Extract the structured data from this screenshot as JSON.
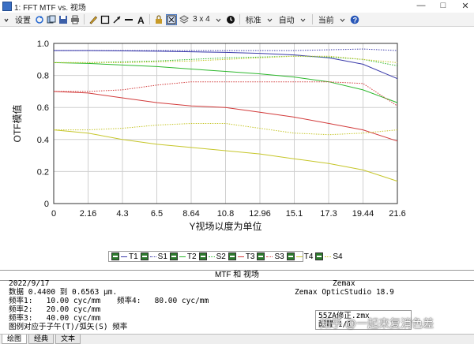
{
  "window": {
    "title": "1: FFT MTF vs. 视场",
    "minimize": "—",
    "maximize": "□",
    "close": "✕"
  },
  "toolbar": {
    "settings_label": "设置",
    "layout_label": "3 x 4",
    "standard_label": "标准",
    "auto_label": "自动",
    "current_label": "当前"
  },
  "chart_data": {
    "type": "line",
    "xlabel": "Y视场以度为单位",
    "ylabel": "OTF模值",
    "xlim": [
      0,
      21.6
    ],
    "ylim": [
      0,
      1.0
    ],
    "xticks": [
      "0",
      "2.16",
      "4.3",
      "6.5",
      "8.64",
      "10.8",
      "12.96",
      "15.1",
      "17.3",
      "19.44",
      "21.6"
    ],
    "yticks": [
      "0",
      "0.2",
      "0.4",
      "0.6",
      "0.8",
      "1.0"
    ],
    "grid": true,
    "series": [
      {
        "name": "T",
        "color": "#3a3aaa",
        "dash": "solid",
        "x": [
          0,
          2.16,
          4.3,
          6.5,
          8.64,
          10.8,
          12.96,
          15.1,
          17.3,
          19.44,
          21.6
        ],
        "y": [
          0.955,
          0.955,
          0.953,
          0.951,
          0.948,
          0.944,
          0.938,
          0.928,
          0.91,
          0.87,
          0.78
        ]
      },
      {
        "name": "S",
        "color": "#3a3aaa",
        "dash": "dotted",
        "x": [
          0,
          2.16,
          4.3,
          6.5,
          8.64,
          10.8,
          12.96,
          15.1,
          17.3,
          19.44,
          21.6
        ],
        "y": [
          0.955,
          0.955,
          0.955,
          0.955,
          0.955,
          0.955,
          0.955,
          0.955,
          0.96,
          0.965,
          0.955
        ]
      },
      {
        "name": "T",
        "color": "#2db82d",
        "dash": "solid",
        "x": [
          0,
          2.16,
          4.3,
          6.5,
          8.64,
          10.8,
          12.96,
          15.1,
          17.3,
          19.44,
          21.6
        ],
        "y": [
          0.88,
          0.875,
          0.865,
          0.855,
          0.84,
          0.825,
          0.81,
          0.79,
          0.76,
          0.71,
          0.63
        ]
      },
      {
        "name": "S",
        "color": "#2db82d",
        "dash": "dotted",
        "x": [
          0,
          2.16,
          4.3,
          6.5,
          8.64,
          10.8,
          12.96,
          15.1,
          17.3,
          19.44,
          21.6
        ],
        "y": [
          0.88,
          0.88,
          0.885,
          0.89,
          0.9,
          0.91,
          0.915,
          0.92,
          0.915,
          0.9,
          0.86
        ]
      },
      {
        "name": "T",
        "color": "#d23b3b",
        "dash": "solid",
        "x": [
          0,
          2.16,
          4.3,
          6.5,
          8.64,
          10.8,
          12.96,
          15.1,
          17.3,
          19.44,
          21.6
        ],
        "y": [
          0.7,
          0.69,
          0.66,
          0.63,
          0.61,
          0.6,
          0.57,
          0.54,
          0.5,
          0.46,
          0.39
        ]
      },
      {
        "name": "S",
        "color": "#d23b3b",
        "dash": "dotted",
        "x": [
          0,
          2.16,
          4.3,
          6.5,
          8.64,
          10.8,
          12.96,
          15.1,
          17.3,
          19.44,
          21.6
        ],
        "y": [
          0.7,
          0.7,
          0.71,
          0.74,
          0.76,
          0.76,
          0.76,
          0.76,
          0.76,
          0.75,
          0.61
        ]
      },
      {
        "name": "T",
        "color": "#c6c62a",
        "dash": "solid",
        "x": [
          0,
          2.16,
          4.3,
          6.5,
          8.64,
          10.8,
          12.96,
          15.1,
          17.3,
          19.44,
          21.6
        ],
        "y": [
          0.46,
          0.44,
          0.4,
          0.37,
          0.35,
          0.33,
          0.31,
          0.28,
          0.25,
          0.21,
          0.14
        ]
      },
      {
        "name": "S",
        "color": "#c6c62a",
        "dash": "dotted",
        "x": [
          0,
          2.16,
          4.3,
          6.5,
          8.64,
          10.8,
          12.96,
          15.1,
          17.3,
          19.44,
          21.6
        ],
        "y": [
          0.46,
          0.46,
          0.47,
          0.49,
          0.5,
          0.5,
          0.47,
          0.44,
          0.43,
          0.44,
          0.46
        ]
      },
      {
        "name": "S",
        "color": "#c6c62a",
        "dash": "dotted",
        "x": [
          0,
          2.16,
          4.3,
          6.5,
          8.64,
          10.8,
          12.96,
          15.1,
          17.3,
          19.44,
          21.6
        ],
        "y": [
          0.88,
          0.88,
          0.88,
          0.885,
          0.89,
          0.9,
          0.91,
          0.92,
          0.92,
          0.9,
          0.88
        ]
      }
    ]
  },
  "legend": {
    "items": [
      {
        "label": "T1",
        "color": "#3a3aaa",
        "dash": "solid"
      },
      {
        "label": "S1",
        "color": "#3a3aaa",
        "dash": "dotted"
      },
      {
        "label": "T2",
        "color": "#2db82d",
        "dash": "solid"
      },
      {
        "label": "S2",
        "color": "#2db82d",
        "dash": "dotted"
      },
      {
        "label": "T3",
        "color": "#d23b3b",
        "dash": "solid"
      },
      {
        "label": "S3",
        "color": "#d23b3b",
        "dash": "dotted"
      },
      {
        "label": "T4",
        "color": "#c6c62a",
        "dash": "solid"
      },
      {
        "label": "S4",
        "color": "#c6c62a",
        "dash": "dotted"
      }
    ]
  },
  "info": {
    "header": "MTF 和 视场",
    "date": "2022/9/17",
    "data_line": "数据 0.4400 到 0.6563 μm.",
    "freq1": "频率1:   10.00 cyc/mm",
    "freq2": "频率2:   20.00 cyc/mm",
    "freq3": "频率3:   40.00 cyc/mm",
    "freq4": "频率4:   80.00 cyc/mm",
    "legend_note": "图例对应于子午(T)/弧矢(S) 频率",
    "vendor": "Zemax",
    "product": "Zemax OpticStudio 18.9",
    "file": "55ZA修正.zmx",
    "config": "配置 1/1"
  },
  "watermark": "知乎 @一起来复消色差",
  "tabs": [
    {
      "label": "绘图",
      "active": true
    },
    {
      "label": "经典",
      "active": false
    },
    {
      "label": "文本",
      "active": false
    }
  ]
}
